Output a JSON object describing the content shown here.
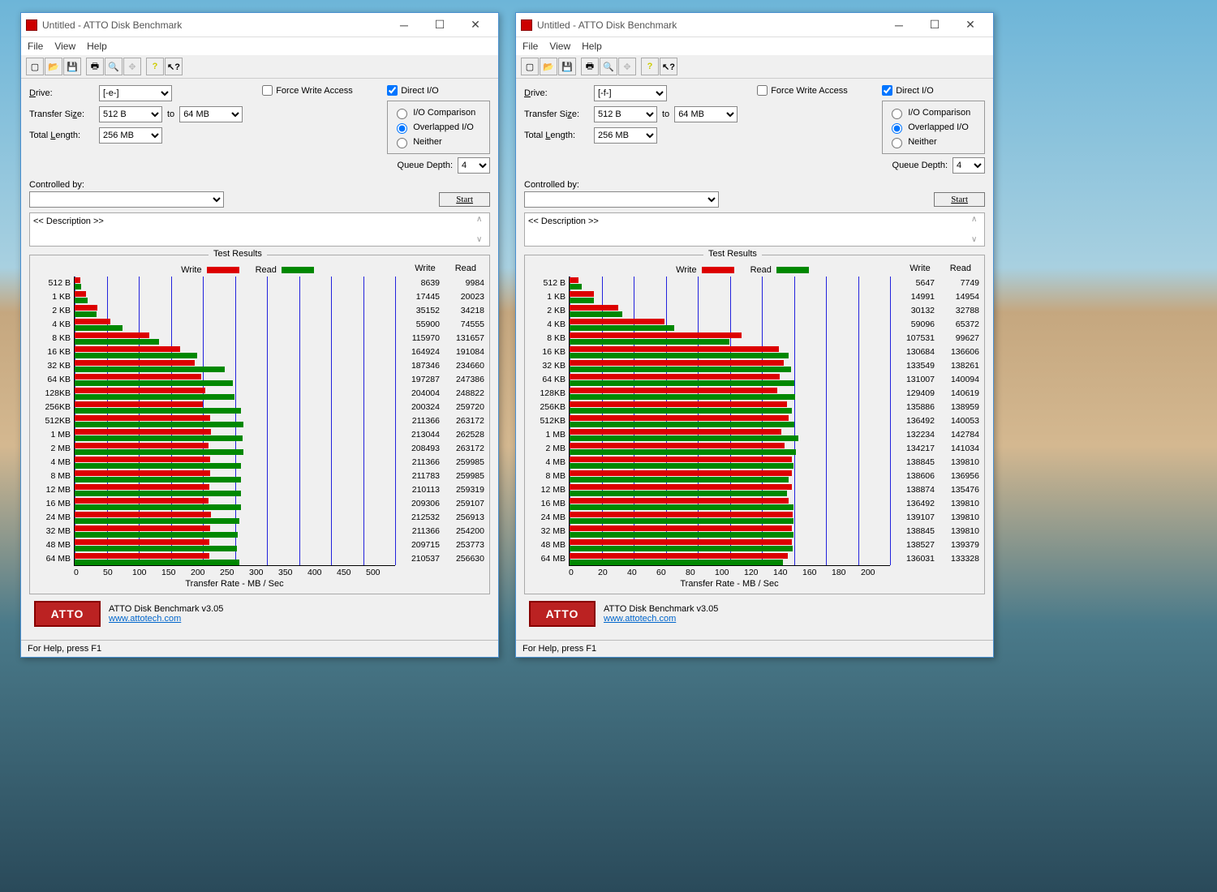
{
  "common": {
    "title": "Untitled - ATTO Disk Benchmark",
    "menu": [
      "File",
      "View",
      "Help"
    ],
    "labels": {
      "drive": "Drive:",
      "transfer_size": "Transfer Size:",
      "to": "to",
      "total_length": "Total Length:",
      "force_write": "Force Write Access",
      "direct_io": "Direct I/O",
      "io_comparison": "I/O Comparison",
      "overlapped_io": "Overlapped I/O",
      "neither": "Neither",
      "queue_depth": "Queue Depth:",
      "controlled_by": "Controlled by:",
      "start": "Start",
      "description": "<< Description >>",
      "test_results": "Test Results",
      "write": "Write",
      "read": "Read",
      "transfer_rate": "Transfer Rate - MB / Sec",
      "brand_name": "ATTO Disk Benchmark v3.05",
      "brand_url": "www.attotech.com",
      "status": "For Help, press F1"
    },
    "transfer_min": "512 B",
    "transfer_max": "64 MB",
    "total_length": "256 MB",
    "queue_depth": "4",
    "row_labels": [
      "512 B",
      "1 KB",
      "2 KB",
      "4 KB",
      "8 KB",
      "16 KB",
      "32 KB",
      "64 KB",
      "128KB",
      "256KB",
      "512KB",
      "1 MB",
      "2 MB",
      "4 MB",
      "8 MB",
      "12 MB",
      "16 MB",
      "24 MB",
      "32 MB",
      "48 MB",
      "64 MB"
    ]
  },
  "windows": [
    {
      "drive": "[-e-]",
      "chart_data": {
        "type": "bar",
        "title": "Test Results",
        "xlabel": "Transfer Rate - MB / Sec",
        "xlim": [
          0,
          500
        ],
        "xticks": [
          0,
          50,
          100,
          150,
          200,
          250,
          300,
          350,
          400,
          450,
          500
        ],
        "categories": [
          "512 B",
          "1 KB",
          "2 KB",
          "4 KB",
          "8 KB",
          "16 KB",
          "32 KB",
          "64 KB",
          "128KB",
          "256KB",
          "512KB",
          "1 MB",
          "2 MB",
          "4 MB",
          "8 MB",
          "12 MB",
          "16 MB",
          "24 MB",
          "32 MB",
          "48 MB",
          "64 MB"
        ],
        "series": [
          {
            "name": "Write",
            "color": "#d00",
            "values": [
              8639,
              17445,
              35152,
              55900,
              115970,
              164924,
              187346,
              197287,
              204004,
              200324,
              211366,
              213044,
              208493,
              211366,
              211783,
              210113,
              209306,
              212532,
              211366,
              209715,
              210537
            ]
          },
          {
            "name": "Read",
            "color": "#080",
            "values": [
              9984,
              20023,
              34218,
              74555,
              131657,
              191084,
              234660,
              247386,
              248822,
              259720,
              263172,
              262528,
              263172,
              259985,
              259985,
              259319,
              259107,
              256913,
              254200,
              253773,
              256630
            ]
          }
        ]
      }
    },
    {
      "drive": "[-f-]",
      "chart_data": {
        "type": "bar",
        "title": "Test Results",
        "xlabel": "Transfer Rate - MB / Sec",
        "xlim": [
          0,
          200
        ],
        "xticks": [
          0,
          20,
          40,
          60,
          80,
          100,
          120,
          140,
          160,
          180,
          200
        ],
        "categories": [
          "512 B",
          "1 KB",
          "2 KB",
          "4 KB",
          "8 KB",
          "16 KB",
          "32 KB",
          "64 KB",
          "128KB",
          "256KB",
          "512KB",
          "1 MB",
          "2 MB",
          "4 MB",
          "8 MB",
          "12 MB",
          "16 MB",
          "24 MB",
          "32 MB",
          "48 MB",
          "64 MB"
        ],
        "series": [
          {
            "name": "Write",
            "color": "#d00",
            "values": [
              5647,
              14991,
              30132,
              59096,
              107531,
              130684,
              133549,
              131007,
              129409,
              135886,
              136492,
              132234,
              134217,
              138845,
              138606,
              138874,
              136492,
              139107,
              138845,
              138527,
              136031
            ]
          },
          {
            "name": "Read",
            "color": "#080",
            "values": [
              7749,
              14954,
              32788,
              65372,
              99627,
              136606,
              138261,
              140094,
              140619,
              138959,
              140053,
              142784,
              141034,
              139810,
              136956,
              135476,
              139810,
              139810,
              139810,
              139379,
              133328
            ]
          }
        ]
      }
    }
  ]
}
